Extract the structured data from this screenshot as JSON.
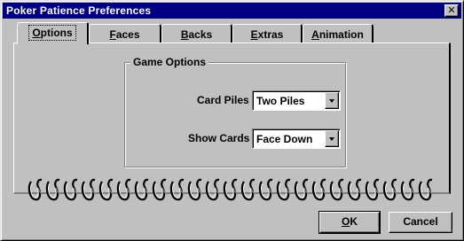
{
  "window": {
    "title": "Poker Patience Preferences",
    "close_glyph": "✕"
  },
  "tabs": [
    {
      "label": "Options",
      "accel": "O",
      "rest": "ptions",
      "active": true
    },
    {
      "label": "Faces",
      "accel": "F",
      "rest": "aces",
      "active": false
    },
    {
      "label": "Backs",
      "accel": "B",
      "rest": "acks",
      "active": false
    },
    {
      "label": "Extras",
      "accel": "E",
      "rest": "xtras",
      "active": false
    },
    {
      "label": "Animation",
      "accel": "A",
      "rest": "nimation",
      "active": false
    }
  ],
  "game_options": {
    "legend": "Game Options",
    "card_piles": {
      "label": "Card Piles",
      "value": "Two Piles"
    },
    "show_cards": {
      "label": "Show Cards",
      "value": "Face Down"
    }
  },
  "buttons": {
    "ok": {
      "accel": "O",
      "rest": "K"
    },
    "cancel": {
      "label": "Cancel"
    }
  },
  "colors": {
    "titlebar": "#000080",
    "face": "#c0c0c0"
  }
}
